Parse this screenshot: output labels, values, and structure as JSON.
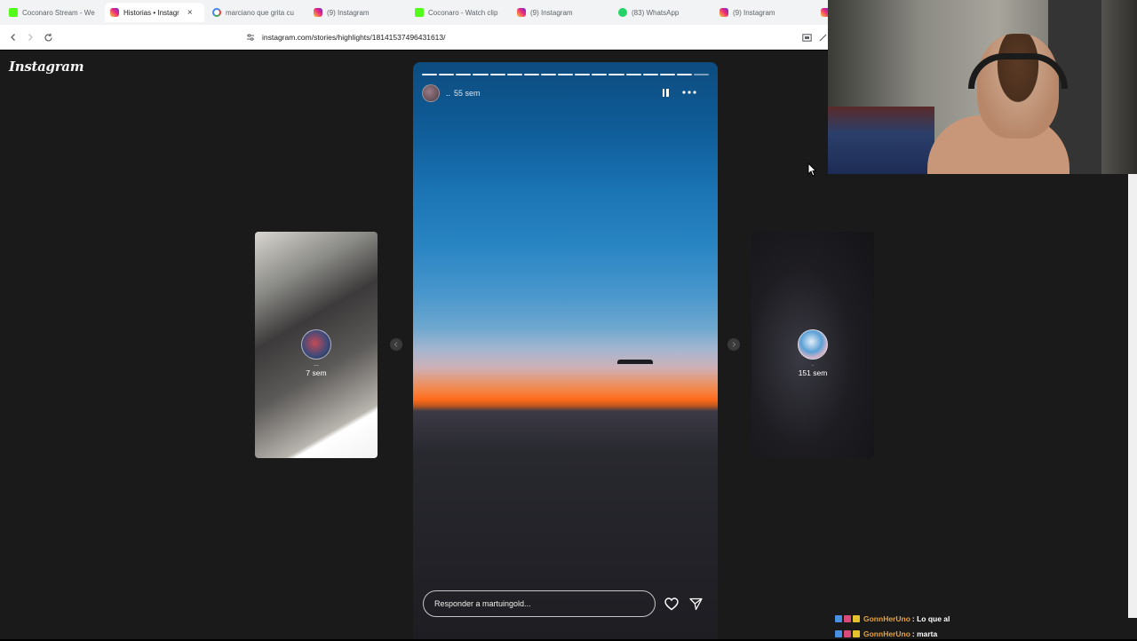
{
  "browser": {
    "tabs": [
      {
        "title": "Coconaro Stream - We",
        "favicon": "kick-icon",
        "active": false
      },
      {
        "title": "Historias • Instagr",
        "favicon": "instagram-icon",
        "active": true
      },
      {
        "title": "marciano que grita cu",
        "favicon": "google-icon",
        "active": false
      },
      {
        "title": "(9) Instagram",
        "favicon": "instagram-icon",
        "active": false
      },
      {
        "title": "Coconaro - Watch clip",
        "favicon": "kick-icon",
        "active": false
      },
      {
        "title": "(9) Instagram",
        "favicon": "instagram-icon",
        "active": false
      },
      {
        "title": "(83) WhatsApp",
        "favicon": "whatsapp-icon",
        "active": false
      },
      {
        "title": "(9) Instagram",
        "favicon": "instagram-icon",
        "active": false
      }
    ],
    "close_symbol": "×",
    "url": "instagram.com/stories/highlights/18141537496431613/"
  },
  "instagram": {
    "logo": "Instagram",
    "story": {
      "username": "..",
      "time": "55 sem",
      "segments": 17,
      "current_segment": 17,
      "reply_placeholder": "Responder a martuingold..."
    },
    "prev_story": {
      "name": "...",
      "time": "7 sem"
    },
    "next_story": {
      "name": ".",
      "time": "151 sem"
    }
  },
  "chat": [
    {
      "user": "GonnHerUno",
      "message": ": Lo que al"
    },
    {
      "user": "GonnHerUno",
      "message": ": marta"
    }
  ],
  "colors": {
    "page_bg": "#1a1a1a",
    "chat_username": "#e9a23b",
    "instagram_gradient": [
      "#f9ce34",
      "#ee2a7b",
      "#6228d7"
    ]
  }
}
